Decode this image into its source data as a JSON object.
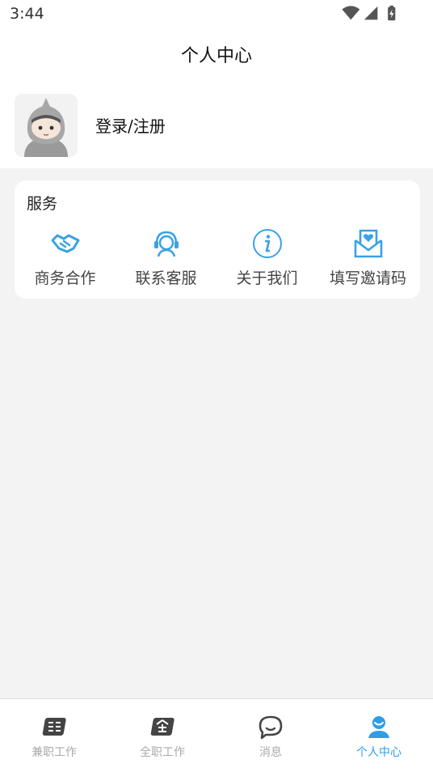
{
  "status_bar": {
    "time": "3:44"
  },
  "header": {
    "title": "个人中心"
  },
  "profile": {
    "login_label": "登录/注册"
  },
  "services": {
    "title": "服务",
    "items": [
      {
        "label": "商务合作",
        "icon": "handshake-icon"
      },
      {
        "label": "联系客服",
        "icon": "customer-service-icon"
      },
      {
        "label": "关于我们",
        "icon": "info-icon"
      },
      {
        "label": "填写邀请码",
        "icon": "invite-code-icon"
      }
    ]
  },
  "tab_bar": {
    "tabs": [
      {
        "label": "兼职工作",
        "icon": "part-time-icon",
        "active": false
      },
      {
        "label": "全职工作",
        "icon": "full-time-icon",
        "active": false
      },
      {
        "label": "消息",
        "icon": "message-icon",
        "active": false
      },
      {
        "label": "个人中心",
        "icon": "user-center-icon",
        "active": true
      }
    ]
  },
  "colors": {
    "accent": "#2f9de8",
    "icon_blue": "#3aa2e4",
    "inactive": "#aaaaaa",
    "background": "#f3f3f3"
  }
}
